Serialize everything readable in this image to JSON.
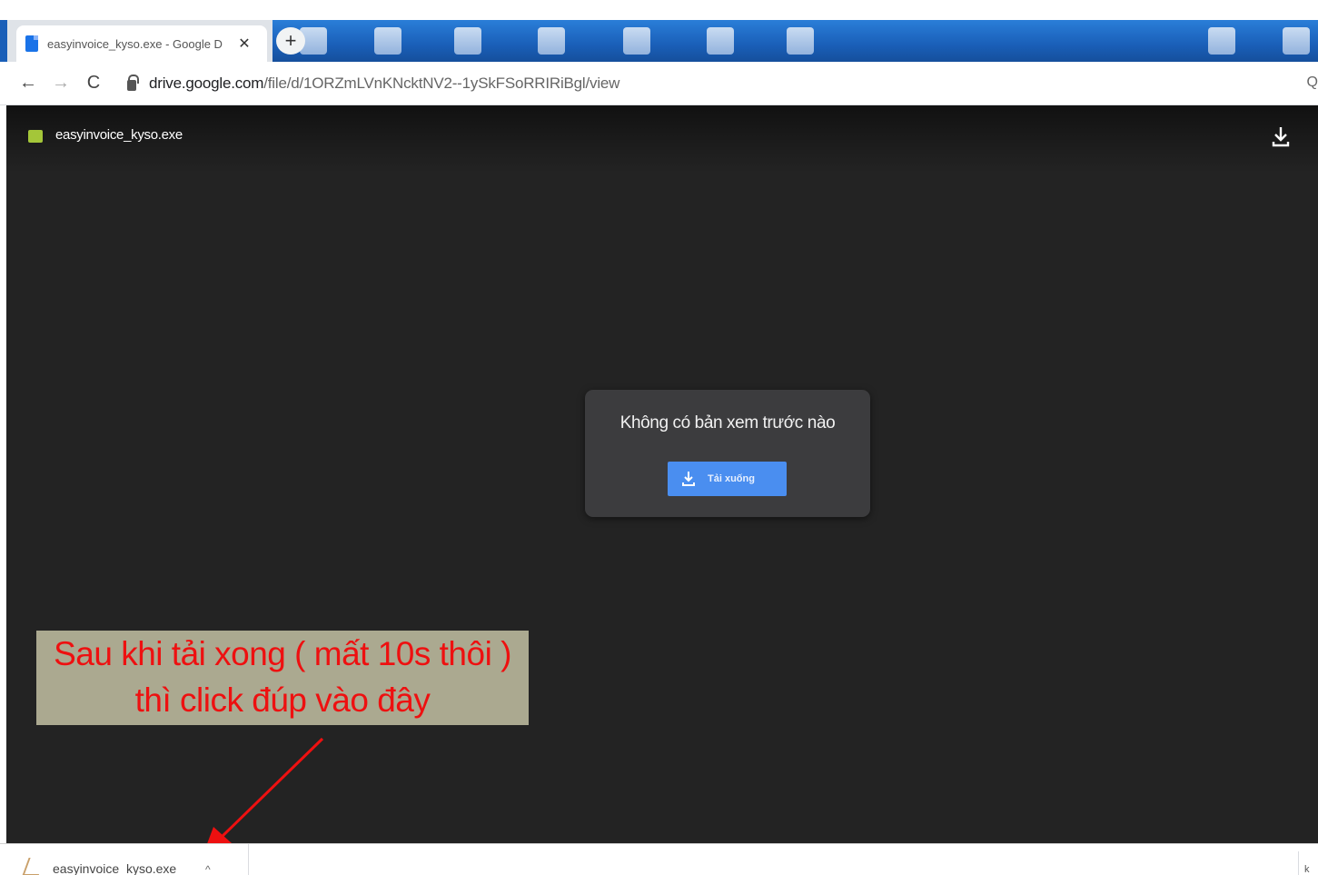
{
  "browser": {
    "tab": {
      "title": "easyinvoice_kyso.exe - Google D",
      "close_symbol": "✕"
    },
    "new_tab_symbol": "+",
    "nav": {
      "back_symbol": "←",
      "forward_symbol": "→",
      "reload_symbol": "C"
    },
    "address": {
      "host": "drive.google.com",
      "path": "/file/d/1ORZmLVnKNcktNV2--1ySkFSoRRIRiBgl/view"
    },
    "zoom_symbol": "Q"
  },
  "viewer": {
    "file_name": "easyinvoice_kyso.exe",
    "no_preview_message": "Không có bản xem trước nào",
    "download_button_label": "Tải xuống"
  },
  "annotation": {
    "line1": "Sau khi tải xong ( mất 10s thôi )",
    "line2": "thì click đúp vào đây",
    "color": "#ee1010"
  },
  "download_shelf": {
    "item_name": "easyinvoice_kyso.exe",
    "chevron_symbol": "^",
    "right_text": "k"
  },
  "colors": {
    "viewer_background": "#232323",
    "download_button": "#4a8ef0",
    "annotation_background": "#aba990"
  }
}
